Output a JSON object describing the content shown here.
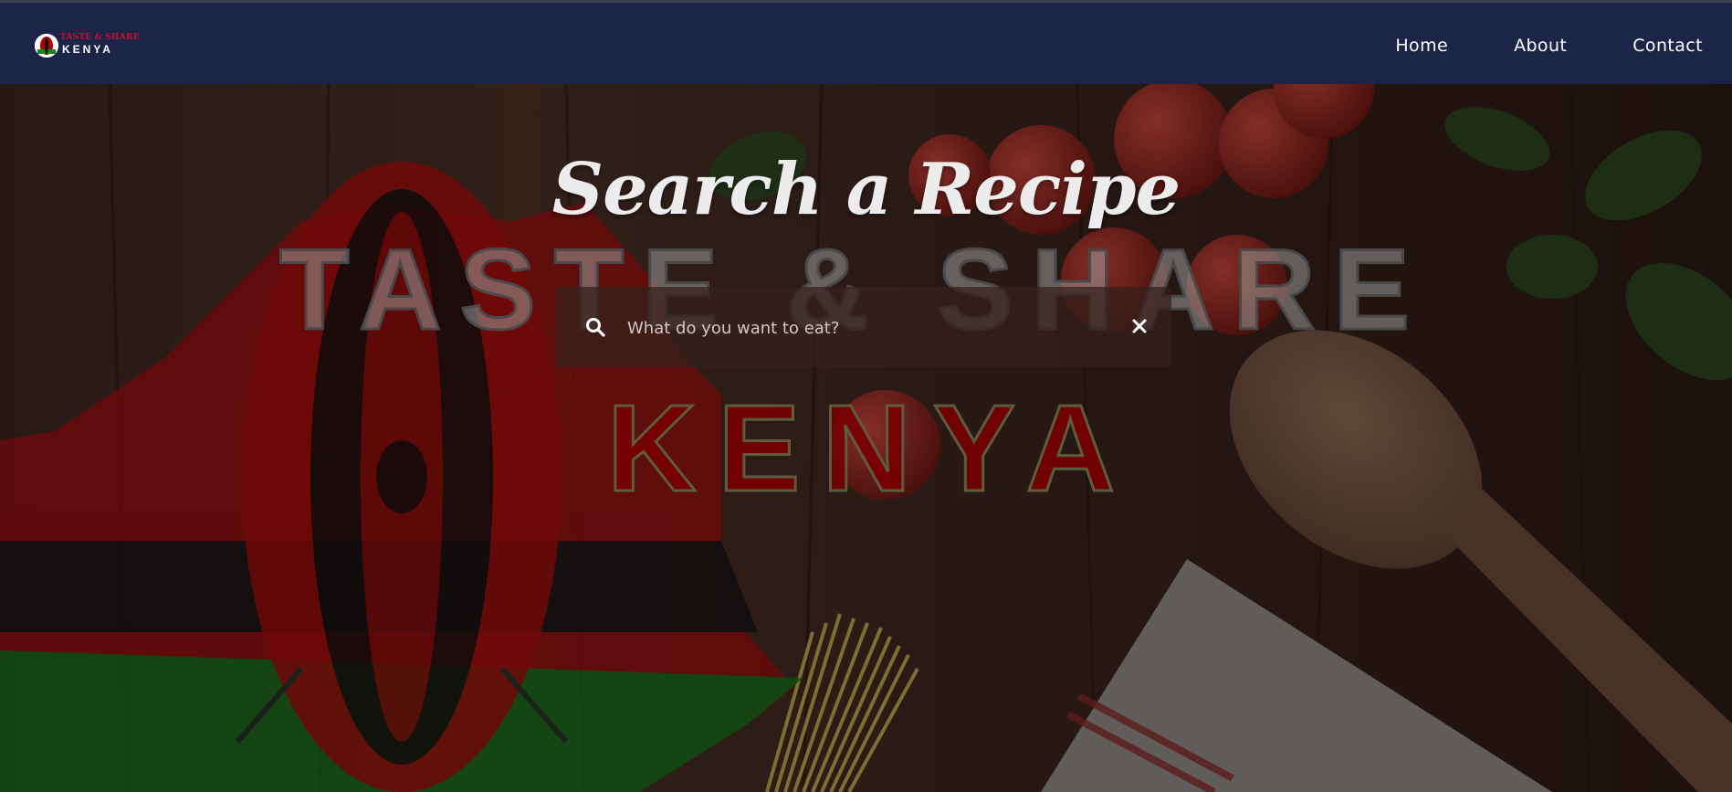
{
  "navbar": {
    "logo": {
      "line1": "TASTE & SHARE",
      "line2": "KENYA"
    },
    "links": [
      {
        "label": "Home"
      },
      {
        "label": "About"
      },
      {
        "label": "Contact"
      }
    ]
  },
  "hero": {
    "title": "Search a Recipe",
    "banner_line1": "TASTE & SHARE",
    "banner_line2": "KENYA",
    "search": {
      "placeholder": "What do you want to eat?",
      "value": ""
    }
  },
  "icons": {
    "search": "search-icon",
    "clear": "close-icon"
  },
  "colors": {
    "navbar": "#1c2447",
    "kenya_red": "#b30000",
    "kenya_green": "#138a1c",
    "text": "#ffffff"
  }
}
